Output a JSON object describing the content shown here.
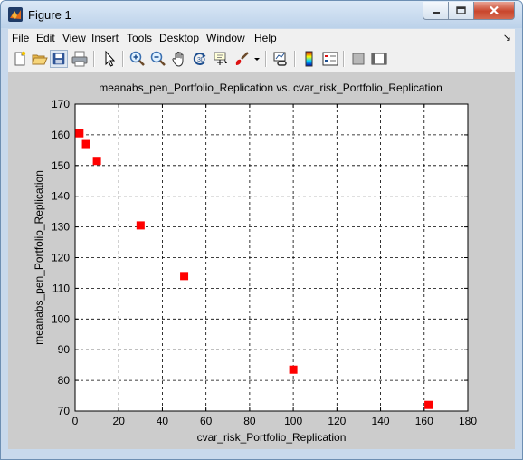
{
  "window": {
    "title": "Figure 1",
    "title_bar_color": "#c6d8ee",
    "close_button_color": "#c9462c"
  },
  "menu": {
    "items": [
      "File",
      "Edit",
      "View",
      "Insert",
      "Tools",
      "Desktop",
      "Window",
      "Help"
    ],
    "dock_icon": "dock-arrow-icon"
  },
  "toolbar": {
    "buttons": [
      {
        "name": "new-figure-icon"
      },
      {
        "name": "open-file-icon"
      },
      {
        "name": "save-figure-icon",
        "pressed": true
      },
      {
        "name": "print-figure-icon"
      },
      {
        "name": "edit-plot-icon"
      },
      {
        "name": "zoom-in-icon"
      },
      {
        "name": "zoom-out-icon"
      },
      {
        "name": "pan-icon"
      },
      {
        "name": "rotate-3d-icon"
      },
      {
        "name": "data-cursor-icon"
      },
      {
        "name": "brush-icon"
      },
      {
        "name": "brush-dropdown-icon"
      },
      {
        "name": "link-plot-icon"
      },
      {
        "name": "insert-colorbar-icon"
      },
      {
        "name": "insert-legend-icon"
      },
      {
        "name": "hide-plot-tools-icon"
      },
      {
        "name": "show-plot-tools-icon"
      }
    ]
  },
  "chart_data": {
    "type": "scatter",
    "title": "meanabs_pen_Portfolio_Replication vs. cvar_risk_Portfolio_Replication",
    "xlabel": "cvar_risk_Portfolio_Replication",
    "ylabel": "meanabs_pen_Portfolio_Replication",
    "xlim": [
      0,
      180
    ],
    "ylim": [
      70,
      170
    ],
    "xticks": [
      0,
      20,
      40,
      60,
      80,
      100,
      120,
      140,
      160,
      180
    ],
    "yticks": [
      70,
      80,
      90,
      100,
      110,
      120,
      130,
      140,
      150,
      160,
      170
    ],
    "grid": true,
    "marker": "square",
    "marker_color": "#ff0000",
    "points": [
      {
        "x": 2,
        "y": 160.5
      },
      {
        "x": 5,
        "y": 157
      },
      {
        "x": 10,
        "y": 151.5
      },
      {
        "x": 30,
        "y": 130.5
      },
      {
        "x": 50,
        "y": 114
      },
      {
        "x": 100,
        "y": 83.5
      },
      {
        "x": 162,
        "y": 72
      }
    ]
  }
}
